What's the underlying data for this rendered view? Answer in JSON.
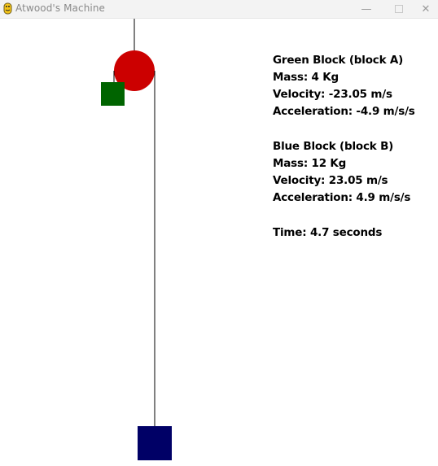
{
  "window": {
    "title": "Atwood's Machine",
    "icon": "python-snake-icon"
  },
  "colors": {
    "pulley": "#cc0000",
    "block_a": "#006400",
    "block_b": "#000066",
    "string": "#000000",
    "background": "#ffffff"
  },
  "block_a": {
    "heading": "Green Block (block A)",
    "mass": "Mass: 4 Kg",
    "velocity": "Velocity: -23.05 m/s",
    "acceleration": "Acceleration: -4.9 m/s/s"
  },
  "block_b": {
    "heading": "Blue Block (block B)",
    "mass": "Mass: 12 Kg",
    "velocity": "Velocity: 23.05 m/s",
    "acceleration": "Acceleration: 4.9 m/s/s"
  },
  "time": "Time: 4.7 seconds"
}
